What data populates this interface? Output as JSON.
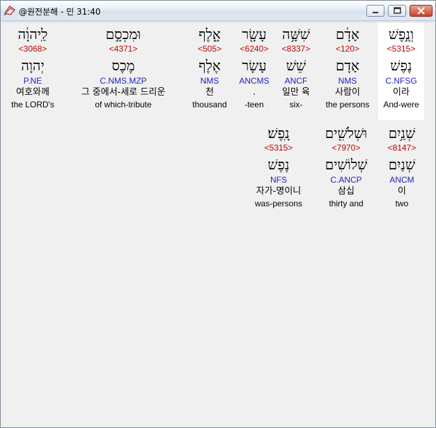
{
  "window": {
    "title": "@원전분해 - 민 31:40",
    "buttons": [
      "minimize",
      "maximize",
      "close"
    ]
  },
  "colors": {
    "strong": "#c00000",
    "morph": "#2020c0",
    "text": "#000000",
    "selected_bg": "#ffffff"
  },
  "words": [
    {
      "hebrew": "וְנֶ֣פֶשׁ",
      "strong": "<5315>",
      "lemma": "נֶפֶשׁ",
      "morph": "C.NFSG",
      "korean": "이라",
      "english": "And-were",
      "selected": true
    },
    {
      "hebrew": "אָדָ֔ם",
      "strong": "<120>",
      "lemma": "אָדָם",
      "morph": "NMS",
      "korean": "사람이",
      "english": "the persons",
      "selected": false
    },
    {
      "hebrew": "שִׁשָּׁ֥ה",
      "strong": "<8337>",
      "lemma": "שֵׁשׁ",
      "morph": "ANCF",
      "korean": "일만 육",
      "english": "six-",
      "selected": false
    },
    {
      "hebrew": "עָשָׂ֖ר",
      "strong": "<6240>",
      "lemma": "עָשָׂר",
      "morph": "ANCMS",
      "korean": ".",
      "english": "-teen",
      "selected": false
    },
    {
      "hebrew": "אָ֑לֶף",
      "strong": "<505>",
      "lemma": "אֶלֶף",
      "morph": "NMS",
      "korean": "천",
      "english": "thousand",
      "selected": false
    },
    {
      "hebrew": "וּמִכְסָ֣ם",
      "strong": "<4371>",
      "lemma": "מֶכֶס",
      "morph": "C.NMS.MZP",
      "korean": "그 중에서-세로 드리운",
      "english": "of which-tribute",
      "selected": false
    },
    {
      "hebrew": "לַֽיהוָ֔ה",
      "strong": "<3068>",
      "lemma": "יְהוָה",
      "morph": "P.NE",
      "korean": "여호와께",
      "english": "the LORD's",
      "selected": false
    },
    {
      "hebrew": "שְׁנַ֥יִם",
      "strong": "<8147>",
      "lemma": "שְׁנַיִם",
      "morph": "ANCM",
      "korean": "이",
      "english": "two",
      "selected": false
    },
    {
      "hebrew": "וּשְׁלֹשִׁ֖ים",
      "strong": "<7970>",
      "lemma": "שְׁלוֹשִׁים",
      "morph": "C.ANCP",
      "korean": "삼십",
      "english": "thirty and",
      "selected": false
    },
    {
      "hebrew": "נָֽפֶשׁ׃",
      "strong": "<5315>",
      "lemma": "נֶפֶשׁ",
      "morph": "NFS",
      "korean": "자가-명이니",
      "english": "was-persons",
      "selected": false
    }
  ]
}
